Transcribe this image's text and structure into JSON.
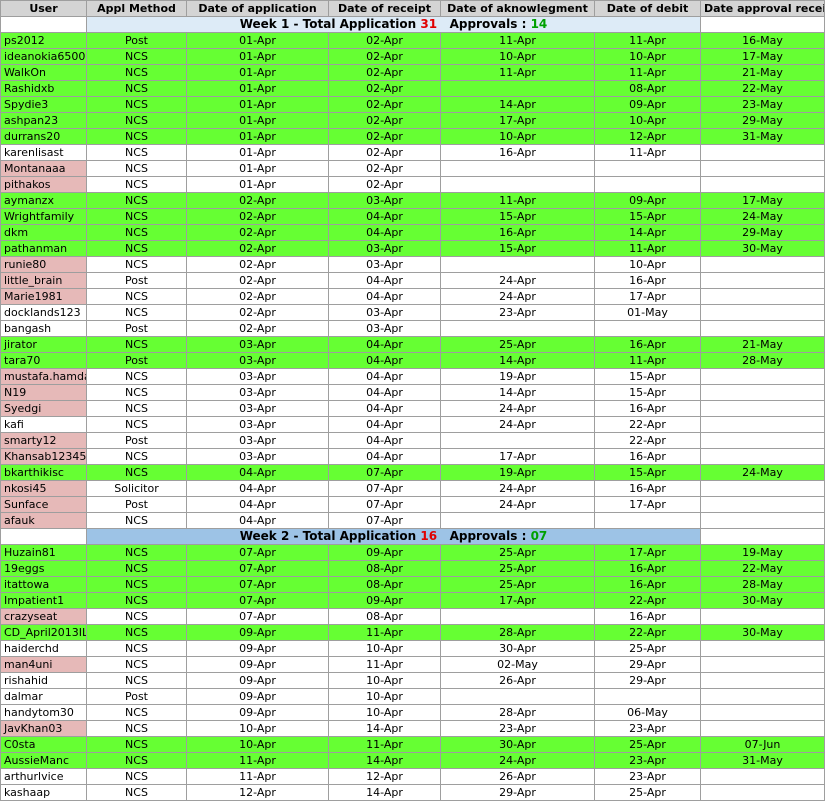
{
  "headers": [
    "User",
    "Appl Method",
    "Date of application",
    "Date of receipt",
    "Date of aknowlegment",
    "Date of debit",
    "Date approval received"
  ],
  "sections": [
    {
      "band_style": "week1",
      "label": "Week 1 - Total Application",
      "total": "31",
      "approvals_label": "Approvals :",
      "approvals": "14",
      "rows": [
        {
          "status": "approved",
          "user": "ps2012",
          "method": "Post",
          "applied": "01-Apr",
          "receipt": "02-Apr",
          "ack": "11-Apr",
          "debit": "11-Apr",
          "approval": "16-May"
        },
        {
          "status": "approved",
          "user": "ideanokia6500",
          "method": "NCS",
          "applied": "01-Apr",
          "receipt": "02-Apr",
          "ack": "10-Apr",
          "debit": "10-Apr",
          "approval": "17-May"
        },
        {
          "status": "approved",
          "user": "WalkOn",
          "method": "NCS",
          "applied": "01-Apr",
          "receipt": "02-Apr",
          "ack": "11-Apr",
          "debit": "11-Apr",
          "approval": "21-May"
        },
        {
          "status": "approved",
          "user": "Rashidxb",
          "method": "NCS",
          "applied": "01-Apr",
          "receipt": "02-Apr",
          "ack": "",
          "debit": "08-Apr",
          "approval": "22-May"
        },
        {
          "status": "approved",
          "user": "Spydie3",
          "method": "NCS",
          "applied": "01-Apr",
          "receipt": "02-Apr",
          "ack": "14-Apr",
          "debit": "09-Apr",
          "approval": "23-May"
        },
        {
          "status": "approved",
          "user": "ashpan23",
          "method": "NCS",
          "applied": "01-Apr",
          "receipt": "02-Apr",
          "ack": "17-Apr",
          "debit": "10-Apr",
          "approval": "29-May"
        },
        {
          "status": "approved",
          "user": "durrans20",
          "method": "NCS",
          "applied": "01-Apr",
          "receipt": "02-Apr",
          "ack": "10-Apr",
          "debit": "12-Apr",
          "approval": "31-May"
        },
        {
          "status": "blank",
          "user": "karenlisast",
          "method": "NCS",
          "applied": "01-Apr",
          "receipt": "02-Apr",
          "ack": "16-Apr",
          "debit": "11-Apr",
          "approval": ""
        },
        {
          "status": "pending",
          "user": "Montanaaa",
          "method": "NCS",
          "applied": "01-Apr",
          "receipt": "02-Apr",
          "ack": "",
          "debit": "",
          "approval": ""
        },
        {
          "status": "pending",
          "user": "pithakos",
          "method": "NCS",
          "applied": "01-Apr",
          "receipt": "02-Apr",
          "ack": "",
          "debit": "",
          "approval": ""
        },
        {
          "status": "approved",
          "user": "aymanzx",
          "method": "NCS",
          "applied": "02-Apr",
          "receipt": "03-Apr",
          "ack": "11-Apr",
          "debit": "09-Apr",
          "approval": "17-May"
        },
        {
          "status": "approved",
          "user": "Wrightfamily",
          "method": "NCS",
          "applied": "02-Apr",
          "receipt": "04-Apr",
          "ack": "15-Apr",
          "debit": "15-Apr",
          "approval": "24-May"
        },
        {
          "status": "approved",
          "user": "dkm",
          "method": "NCS",
          "applied": "02-Apr",
          "receipt": "04-Apr",
          "ack": "16-Apr",
          "debit": "14-Apr",
          "approval": "29-May"
        },
        {
          "status": "approved",
          "user": "pathanman",
          "method": "NCS",
          "applied": "02-Apr",
          "receipt": "03-Apr",
          "ack": "15-Apr",
          "debit": "11-Apr",
          "approval": "30-May"
        },
        {
          "status": "pending",
          "user": "runie80",
          "method": "NCS",
          "applied": "02-Apr",
          "receipt": "03-Apr",
          "ack": "",
          "debit": "10-Apr",
          "approval": ""
        },
        {
          "status": "pending",
          "user": "little_brain",
          "method": "Post",
          "applied": "02-Apr",
          "receipt": "04-Apr",
          "ack": "24-Apr",
          "debit": "16-Apr",
          "approval": ""
        },
        {
          "status": "pending",
          "user": "Marie1981",
          "method": "NCS",
          "applied": "02-Apr",
          "receipt": "04-Apr",
          "ack": "24-Apr",
          "debit": "17-Apr",
          "approval": ""
        },
        {
          "status": "blank",
          "user": "docklands123",
          "method": "NCS",
          "applied": "02-Apr",
          "receipt": "03-Apr",
          "ack": "23-Apr",
          "debit": "01-May",
          "approval": ""
        },
        {
          "status": "blank",
          "user": "bangash",
          "method": "Post",
          "applied": "02-Apr",
          "receipt": "03-Apr",
          "ack": "",
          "debit": "",
          "approval": ""
        },
        {
          "status": "approved",
          "user": "jirator",
          "method": "NCS",
          "applied": "03-Apr",
          "receipt": "04-Apr",
          "ack": "25-Apr",
          "debit": "16-Apr",
          "approval": "21-May"
        },
        {
          "status": "approved",
          "user": "tara70",
          "method": "Post",
          "applied": "03-Apr",
          "receipt": "04-Apr",
          "ack": "14-Apr",
          "debit": "11-Apr",
          "approval": "28-May"
        },
        {
          "status": "pending",
          "user": "mustafa.hamda",
          "method": "NCS",
          "applied": "03-Apr",
          "receipt": "04-Apr",
          "ack": "19-Apr",
          "debit": "15-Apr",
          "approval": ""
        },
        {
          "status": "pending",
          "user": "N19",
          "method": "NCS",
          "applied": "03-Apr",
          "receipt": "04-Apr",
          "ack": "14-Apr",
          "debit": "15-Apr",
          "approval": ""
        },
        {
          "status": "pending",
          "user": "Syedgi",
          "method": "NCS",
          "applied": "03-Apr",
          "receipt": "04-Apr",
          "ack": "24-Apr",
          "debit": "16-Apr",
          "approval": ""
        },
        {
          "status": "blank",
          "user": "kafi",
          "method": "NCS",
          "applied": "03-Apr",
          "receipt": "04-Apr",
          "ack": "24-Apr",
          "debit": "22-Apr",
          "approval": ""
        },
        {
          "status": "pending",
          "user": "smarty12",
          "method": "Post",
          "applied": "03-Apr",
          "receipt": "04-Apr",
          "ack": "",
          "debit": "22-Apr",
          "approval": ""
        },
        {
          "status": "pending",
          "user": "Khansab12345",
          "method": "NCS",
          "applied": "03-Apr",
          "receipt": "04-Apr",
          "ack": "17-Apr",
          "debit": "16-Apr",
          "approval": ""
        },
        {
          "status": "approved",
          "user": "bkarthikisc",
          "method": "NCS",
          "applied": "04-Apr",
          "receipt": "07-Apr",
          "ack": "19-Apr",
          "debit": "15-Apr",
          "approval": "24-May"
        },
        {
          "status": "pending",
          "user": "nkosi45",
          "method": "Solicitor",
          "applied": "04-Apr",
          "receipt": "07-Apr",
          "ack": "24-Apr",
          "debit": "16-Apr",
          "approval": ""
        },
        {
          "status": "pending",
          "user": "Sunface",
          "method": "Post",
          "applied": "04-Apr",
          "receipt": "07-Apr",
          "ack": "24-Apr",
          "debit": "17-Apr",
          "approval": ""
        },
        {
          "status": "pending",
          "user": "afauk",
          "method": "NCS",
          "applied": "04-Apr",
          "receipt": "07-Apr",
          "ack": "",
          "debit": "",
          "approval": ""
        }
      ]
    },
    {
      "band_style": "week2",
      "label": "Week 2 - Total Application",
      "total": "16",
      "approvals_label": "Approvals :",
      "approvals": "07",
      "rows": [
        {
          "status": "approved",
          "user": "Huzain81",
          "method": "NCS",
          "applied": "07-Apr",
          "receipt": "09-Apr",
          "ack": "25-Apr",
          "debit": "17-Apr",
          "approval": "19-May"
        },
        {
          "status": "approved",
          "user": "19eggs",
          "method": "NCS",
          "applied": "07-Apr",
          "receipt": "08-Apr",
          "ack": "25-Apr",
          "debit": "16-Apr",
          "approval": "22-May"
        },
        {
          "status": "approved",
          "user": "itattowa",
          "method": "NCS",
          "applied": "07-Apr",
          "receipt": "08-Apr",
          "ack": "25-Apr",
          "debit": "16-Apr",
          "approval": "28-May"
        },
        {
          "status": "approved",
          "user": "Impatient1",
          "method": "NCS",
          "applied": "07-Apr",
          "receipt": "09-Apr",
          "ack": "17-Apr",
          "debit": "22-Apr",
          "approval": "30-May"
        },
        {
          "status": "pending",
          "user": "crazyseat",
          "method": "NCS",
          "applied": "07-Apr",
          "receipt": "08-Apr",
          "ack": "",
          "debit": "16-Apr",
          "approval": ""
        },
        {
          "status": "approved",
          "user": "CD_April2013ILR",
          "method": "NCS",
          "applied": "09-Apr",
          "receipt": "11-Apr",
          "ack": "28-Apr",
          "debit": "22-Apr",
          "approval": "30-May"
        },
        {
          "status": "blank",
          "user": "haiderchd",
          "method": "NCS",
          "applied": "09-Apr",
          "receipt": "10-Apr",
          "ack": "30-Apr",
          "debit": "25-Apr",
          "approval": ""
        },
        {
          "status": "pending",
          "user": "man4uni",
          "method": "NCS",
          "applied": "09-Apr",
          "receipt": "11-Apr",
          "ack": "02-May",
          "debit": "29-Apr",
          "approval": ""
        },
        {
          "status": "blank",
          "user": "rishahid",
          "method": "NCS",
          "applied": "09-Apr",
          "receipt": "10-Apr",
          "ack": "26-Apr",
          "debit": "29-Apr",
          "approval": ""
        },
        {
          "status": "blank",
          "user": "dalmar",
          "method": "Post",
          "applied": "09-Apr",
          "receipt": "10-Apr",
          "ack": "",
          "debit": "",
          "approval": ""
        },
        {
          "status": "blank",
          "user": "handytom30",
          "method": "NCS",
          "applied": "09-Apr",
          "receipt": "10-Apr",
          "ack": "28-Apr",
          "debit": "06-May",
          "approval": ""
        },
        {
          "status": "pending",
          "user": "JavKhan03",
          "method": "NCS",
          "applied": "10-Apr",
          "receipt": "14-Apr",
          "ack": "23-Apr",
          "debit": "23-Apr",
          "approval": ""
        },
        {
          "status": "approved",
          "user": "C0sta",
          "method": "NCS",
          "applied": "10-Apr",
          "receipt": "11-Apr",
          "ack": "30-Apr",
          "debit": "25-Apr",
          "approval": "07-Jun"
        },
        {
          "status": "approved",
          "user": "AussieManc",
          "method": "NCS",
          "applied": "11-Apr",
          "receipt": "14-Apr",
          "ack": "24-Apr",
          "debit": "23-Apr",
          "approval": "31-May"
        },
        {
          "status": "blank",
          "user": "arthurlvice",
          "method": "NCS",
          "applied": "11-Apr",
          "receipt": "12-Apr",
          "ack": "26-Apr",
          "debit": "23-Apr",
          "approval": ""
        },
        {
          "status": "blank",
          "user": "kashaap",
          "method": "NCS",
          "applied": "12-Apr",
          "receipt": "14-Apr",
          "ack": "29-Apr",
          "debit": "25-Apr",
          "approval": ""
        }
      ]
    }
  ]
}
